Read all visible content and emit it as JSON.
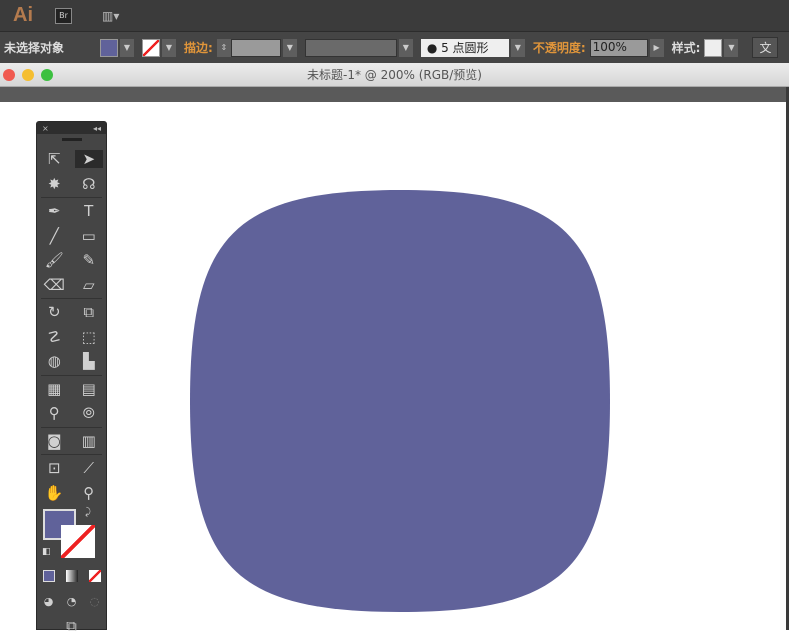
{
  "app": {
    "logo": "Ai",
    "bridge": "Br",
    "layout_icon": "▥▾"
  },
  "control": {
    "selection_label": "未选择对象",
    "fill_color": "#60629a",
    "stroke_label": "描边:",
    "brush_value": "5 点圆形",
    "opacity_label": "不透明度:",
    "opacity_value": "100%",
    "style_label": "样式:",
    "doc_button": "文"
  },
  "window": {
    "title": "未标题-1* @ 200% (RGB/预览)"
  },
  "tools": {
    "close": "×",
    "collapse": "◂◂",
    "rows": [
      [
        "selection-tool",
        "direct-selection-tool"
      ],
      [
        "magic-wand-tool",
        "lasso-tool"
      ],
      [
        "pen-tool",
        "type-tool"
      ],
      [
        "line-tool",
        "rectangle-tool"
      ],
      [
        "paintbrush-tool",
        "pencil-tool"
      ],
      [
        "blob-brush-tool",
        "eraser-tool"
      ],
      [
        "rotate-tool",
        "scale-tool"
      ],
      [
        "warp-tool",
        "free-transform-tool"
      ],
      [
        "shape-builder-tool",
        "perspective-grid-tool"
      ],
      [
        "mesh-tool",
        "gradient-tool"
      ],
      [
        "eyedropper-tool",
        "blend-tool"
      ],
      [
        "symbol-sprayer-tool",
        "column-graph-tool"
      ],
      [
        "artboard-tool",
        "slice-tool"
      ],
      [
        "hand-tool",
        "zoom-tool"
      ]
    ],
    "glyphs": [
      [
        "⇱",
        "➤"
      ],
      [
        "✸",
        "☊"
      ],
      [
        "✒",
        "T"
      ],
      [
        "╱",
        "▭"
      ],
      [
        "🖌",
        "✎"
      ],
      [
        "⌫",
        "▱"
      ],
      [
        "↻",
        "⧉"
      ],
      [
        "☡",
        "⬚"
      ],
      [
        "◍",
        "▙"
      ],
      [
        "▦",
        "▤"
      ],
      [
        "⚲",
        "⦾"
      ],
      [
        "◙",
        "▥"
      ],
      [
        "⊡",
        "⟋"
      ],
      [
        "✋",
        "⚲"
      ]
    ]
  },
  "shape": {
    "fill": "#60629a"
  }
}
